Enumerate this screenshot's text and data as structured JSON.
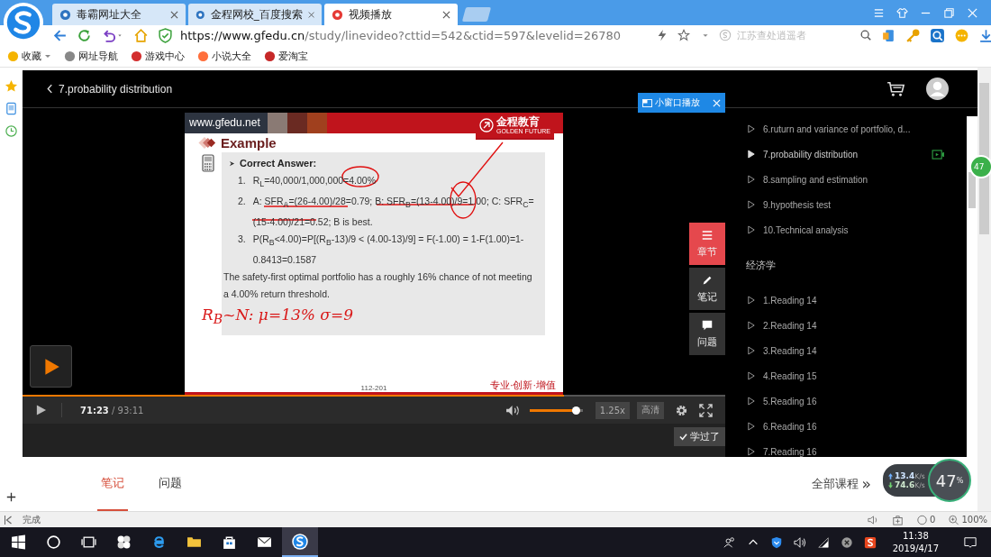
{
  "browser": {
    "tabs": [
      {
        "title": "毒霸网址大全",
        "selected": false
      },
      {
        "title": "金程网校_百度搜索",
        "selected": false
      },
      {
        "title": "视频播放",
        "selected": true
      }
    ],
    "url_host": "https://www.gfedu.cn",
    "url_path": "/study/linevideo?cttid=542&ctid=597&levelid=26780",
    "search_placeholder": "江苏查处逍遥者",
    "bookmarks": [
      "收藏",
      "网址导航",
      "游戏中心",
      "小说大全",
      "爱淘宝"
    ]
  },
  "page": {
    "back_title": "7.probability distribution",
    "mini_player": "小窗口播放",
    "slide": {
      "site": "www.gfedu.net",
      "logo_cn": "金程教育",
      "logo_en": "GOLDEN FUTURE",
      "title": "Example",
      "heading": "Correct Answer:",
      "items": [
        {
          "num": "1.",
          "text": "R$_{L}$=40,000/1,000,000=4.00%"
        },
        {
          "num": "2.",
          "text": "A: SFR$_{A}$=(26-4.00)/28=0.79; B: SFR$_{B}$=(13-4.00)/9=1.00; C: SFR$_{C}$=(15-4.00)/21=0.52; B is best."
        },
        {
          "num": "3.",
          "text": "P(R$_{B}$<4.00)=P[(R$_{B}$-13)/9 < (4.00-13)/9] = F(-1.00) = 1-F(1.00)=1-0.8413=0.1587"
        }
      ],
      "conclusion": "The safety-first optimal portfolio has a roughly 16% chance of not meeting a 4.00% return threshold.",
      "handwritten_note": "R$_{B}$~N: μ=13% σ=9",
      "page_number": "112-201",
      "motto": "专业·创新·增值"
    },
    "side_buttons": [
      {
        "label": "章节",
        "kind": "menu",
        "selected": true
      },
      {
        "label": "笔记",
        "kind": "pen",
        "selected": false
      },
      {
        "label": "问题",
        "kind": "chat",
        "selected": false
      }
    ],
    "player": {
      "current": "71:23",
      "total": "/ 93:11",
      "level": 0.77,
      "volume": {
        "level": 0.95
      },
      "speed": "1.25x",
      "quality": "高清",
      "learned": "学过了"
    },
    "course_list": [
      {
        "kind": "lesson",
        "title": "6.ruturn and variance of portfolio, d...",
        "selected": false
      },
      {
        "kind": "lesson",
        "title": "7.probability distribution",
        "selected": true
      },
      {
        "kind": "lesson",
        "title": "8.sampling and estimation",
        "selected": false
      },
      {
        "kind": "lesson",
        "title": "9.hypothesis test",
        "selected": false
      },
      {
        "kind": "lesson",
        "title": "10.Technical analysis",
        "selected": false
      },
      {
        "kind": "section",
        "title": "经济学"
      },
      {
        "kind": "lesson",
        "title": "1.Reading 14",
        "selected": false
      },
      {
        "kind": "lesson",
        "title": "2.Reading 14",
        "selected": false
      },
      {
        "kind": "lesson",
        "title": "3.Reading 14",
        "selected": false
      },
      {
        "kind": "lesson",
        "title": "4.Reading 15",
        "selected": false
      },
      {
        "kind": "lesson",
        "title": "5.Reading 16",
        "selected": false
      },
      {
        "kind": "lesson",
        "title": "6.Reading 16",
        "selected": false
      },
      {
        "kind": "lesson",
        "title": "7.Reading 16",
        "selected": false
      }
    ],
    "bottom_tabs": [
      {
        "label": "笔记",
        "selected": true
      },
      {
        "label": "问题",
        "selected": false
      }
    ],
    "all_courses": "全部课程",
    "all_courses_arrow": "»"
  },
  "float_badge": "47",
  "network_widget": {
    "up": "13.4",
    "up_unit": "K/s",
    "down": "74.6",
    "down_unit": "K/s",
    "percent": "47",
    "percent_sign": "%"
  },
  "status_bar": {
    "text": "完成",
    "blocked_count": "0",
    "zoom": "100%"
  },
  "taskbar": {
    "time": "11:38",
    "date": "2019/4/17"
  }
}
